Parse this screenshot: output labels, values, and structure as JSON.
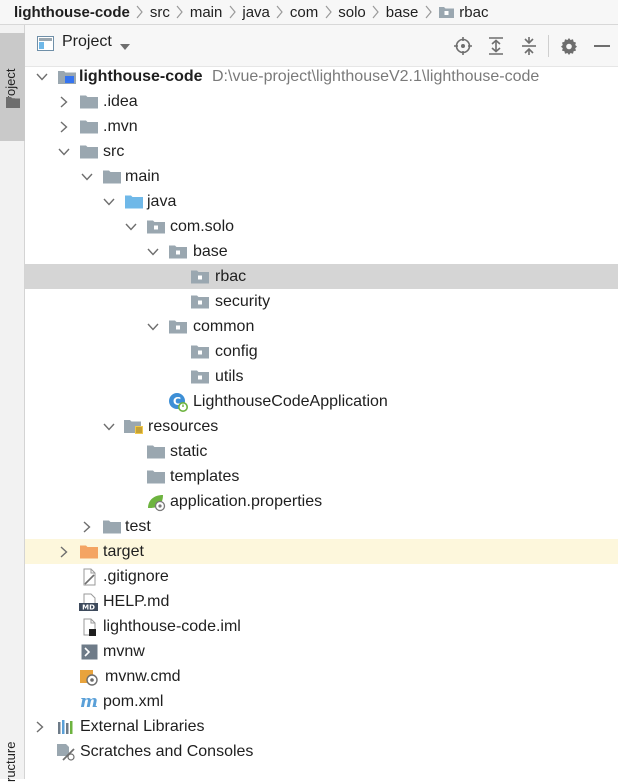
{
  "breadcrumb": {
    "items": [
      "lighthouse-code",
      "src",
      "main",
      "java",
      "com",
      "solo",
      "base",
      "rbac"
    ]
  },
  "toolstripe": {
    "project_tab": "Project",
    "structure_tab": "ructure"
  },
  "panel": {
    "view_selector": "Project",
    "actions": [
      "locate-icon",
      "expand-all-icon",
      "collapse-all-icon",
      "gear-icon",
      "minimize-icon"
    ]
  },
  "tree": {
    "root": {
      "name": "lighthouse-code",
      "path": "D:\\vue-project\\lighthouseV2.1\\lighthouse-code"
    },
    "nodes": [
      ".idea",
      ".mvn",
      "src",
      "main",
      "java",
      "com.solo",
      "base",
      "rbac",
      "security",
      "common",
      "config",
      "utils",
      "LighthouseCodeApplication",
      "resources",
      "static",
      "templates",
      "application.properties",
      "test",
      "target",
      ".gitignore",
      "HELP.md",
      "lighthouse-code.iml",
      "mvnw",
      "mvnw.cmd",
      "pom.xml"
    ],
    "external_libraries": "External Libraries",
    "scratches": "Scratches and Consoles",
    "selected": "rbac",
    "excluded": "target"
  },
  "colors": {
    "selection": "#d5d5d5",
    "excluded_bg": "#fdf7dc",
    "folder": "#9aa7b0",
    "source_folder": "#6fb8e8",
    "excluded_folder": "#f4a462",
    "path_text": "#7a7a7a"
  }
}
